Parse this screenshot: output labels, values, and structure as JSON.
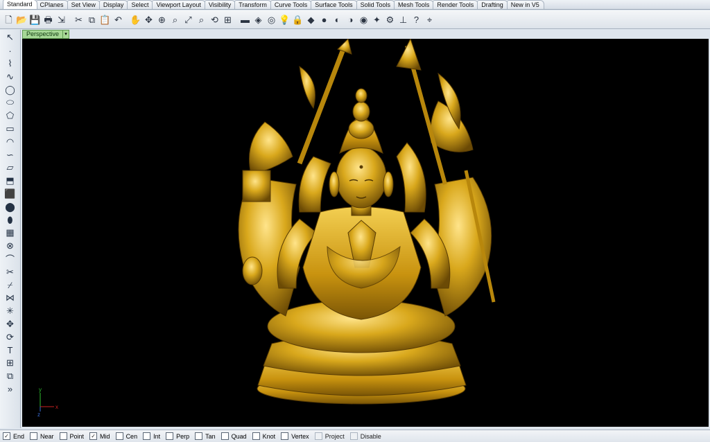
{
  "tabs": [
    "Standard",
    "CPlanes",
    "Set View",
    "Display",
    "Select",
    "Viewport Layout",
    "Visibility",
    "Transform",
    "Curve Tools",
    "Surface Tools",
    "Solid Tools",
    "Mesh Tools",
    "Render Tools",
    "Drafting",
    "New in V5"
  ],
  "active_tab": "Standard",
  "toolbar_icons": [
    "new-document-icon",
    "open-folder-icon",
    "save-icon",
    "print-icon",
    "import-icon",
    "cut-icon",
    "copy-icon",
    "paste-icon",
    "undo-icon",
    "pan-hand-icon",
    "rotate-view-icon",
    "zoom-in-icon",
    "zoom-window-icon",
    "zoom-extents-icon",
    "zoom-selected-icon",
    "zoom-dynamic-icon",
    "viewport-grid-icon",
    "properties-icon",
    "layer-icon",
    "object-snap-icon",
    "light-bulb-icon",
    "lock-icon",
    "color-swatch-icon",
    "shade-mode-icon",
    "rendered-mode-icon",
    "ghosted-mode-icon",
    "sphere-render-icon",
    "magic-wand-icon",
    "gear-options-icon",
    "dimension-icon",
    "help-icon",
    "smart-track-icon"
  ],
  "left_tool_icons": [
    "select-arrow-icon",
    "point-icon",
    "polyline-icon",
    "curve-icon",
    "circle-icon",
    "ellipse-icon",
    "polygon-icon",
    "rectangle-icon",
    "arc-icon",
    "freeform-curve-icon",
    "surface-icon",
    "extrude-icon",
    "box-solid-icon",
    "sphere-solid-icon",
    "cylinder-solid-icon",
    "mesh-icon",
    "boolean-icon",
    "fillet-icon",
    "trim-icon",
    "split-icon",
    "join-icon",
    "explode-icon",
    "move-icon",
    "rotate-icon",
    "text-icon",
    "array-icon",
    "group-icon",
    "more-icon"
  ],
  "viewport": {
    "name": "Perspective",
    "menu_icon": "dropdown-arrow-icon",
    "background": "#000000",
    "axis_labels": {
      "y": "y",
      "z": "z",
      "x": "x"
    },
    "axis_colors": {
      "x": "#cc2222",
      "y": "#2fbf2f",
      "z": "#3a6fd8"
    },
    "model": "golden seated multi-armed deity statue on lotus pedestal",
    "model_color": "#d6a91e"
  },
  "snaps": [
    {
      "label": "End",
      "checked": true,
      "enabled": true
    },
    {
      "label": "Near",
      "checked": false,
      "enabled": true
    },
    {
      "label": "Point",
      "checked": false,
      "enabled": true
    },
    {
      "label": "Mid",
      "checked": true,
      "enabled": true
    },
    {
      "label": "Cen",
      "checked": false,
      "enabled": true
    },
    {
      "label": "Int",
      "checked": false,
      "enabled": true
    },
    {
      "label": "Perp",
      "checked": false,
      "enabled": true
    },
    {
      "label": "Tan",
      "checked": false,
      "enabled": true
    },
    {
      "label": "Quad",
      "checked": false,
      "enabled": true
    },
    {
      "label": "Knot",
      "checked": false,
      "enabled": true
    },
    {
      "label": "Vertex",
      "checked": false,
      "enabled": true
    },
    {
      "label": "Project",
      "checked": false,
      "enabled": false
    },
    {
      "label": "Disable",
      "checked": false,
      "enabled": false
    }
  ]
}
